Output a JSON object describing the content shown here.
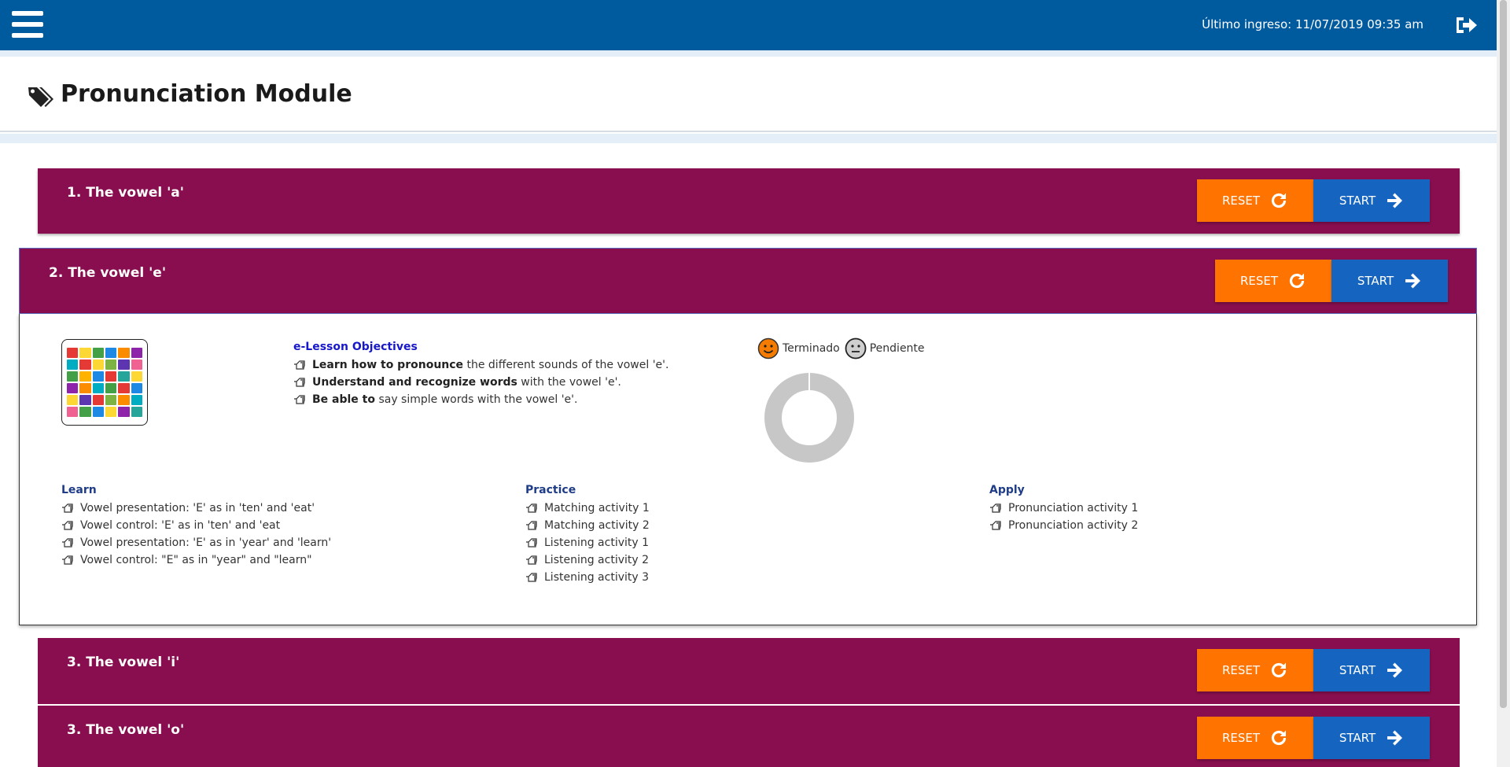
{
  "header": {
    "last_login": "Último ingreso: 11/07/2019 09:35 am",
    "menu_icon": "hamburger-menu-icon",
    "logout_icon": "sign-out-icon",
    "bar_color": "#005a9e"
  },
  "page": {
    "title": "Pronunciation Module",
    "icon": "tags-icon"
  },
  "buttons": {
    "reset": "RESET",
    "start": "START",
    "reset_color": "#ff7300",
    "start_color": "#1565c0"
  },
  "modules": [
    {
      "title": "1. The vowel 'a'"
    },
    {
      "title": "2. The vowel 'e'"
    },
    {
      "title": "3. The vowel 'i'"
    },
    {
      "title": "3. The vowel 'o'"
    }
  ],
  "module_color": "#880e4f",
  "expanded": {
    "objectives_title": "e-Lesson Objectives",
    "objectives": [
      {
        "bold": "Learn how to pronounce",
        "rest": " the different sounds of the vowel 'e'."
      },
      {
        "bold": "Understand and recognize words",
        "rest": " with the vowel 'e'."
      },
      {
        "bold": "Be able to",
        "rest": " say simple words with the vowel 'e'."
      }
    ],
    "legend": {
      "done": "Terminado",
      "pending": "Pendiente"
    },
    "progress": {
      "completed_fraction": 0.0
    },
    "learn": {
      "title": "Learn",
      "items": [
        "Vowel presentation: 'E' as in 'ten' and 'eat'",
        "Vowel control: 'E' as in 'ten' and 'eat",
        "Vowel presentation: 'E' as in 'year' and 'learn'",
        "Vowel control: \"E\" as in \"year\" and \"learn\""
      ]
    },
    "practice": {
      "title": "Practice",
      "items": [
        "Matching activity 1",
        "Matching activity 2",
        "Listening activity 1",
        "Listening activity 2",
        "Listening activity 3"
      ]
    },
    "apply": {
      "title": "Apply",
      "items": [
        "Pronunciation activity 1",
        "Pronunciation activity 2"
      ]
    }
  }
}
